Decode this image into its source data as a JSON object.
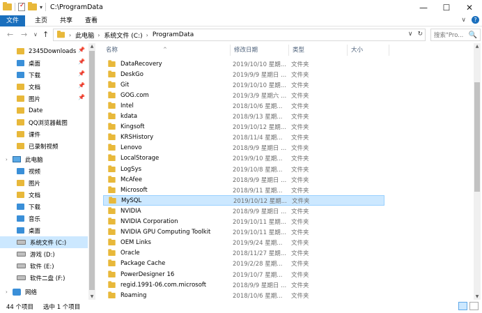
{
  "window": {
    "title": "C:\\ProgramData",
    "controls": {
      "minimize": "—",
      "maximize": "☐",
      "close": "✕"
    },
    "quick_access_dropdown": "▾"
  },
  "ribbon": {
    "tabs": [
      "文件",
      "主页",
      "共享",
      "查看"
    ],
    "expand_icon": "∨",
    "help_icon": "?"
  },
  "nav": {
    "back": "←",
    "forward": "→",
    "recent": "∨",
    "up": "↑",
    "breadcrumb": [
      "此电脑",
      "系统文件 (C:)",
      "ProgramData"
    ],
    "crumb_separator": "›",
    "address_dropdown": "∨",
    "refresh": "↻",
    "search_placeholder": "搜索\"Pro...",
    "search_icon": "🔍"
  },
  "sidebar": {
    "quick_access": [
      {
        "label": "2345Downloads",
        "icon": "folder-icon",
        "pinned": true
      },
      {
        "label": "桌面",
        "icon": "desktop-icon",
        "pinned": true
      },
      {
        "label": "下载",
        "icon": "download-icon",
        "pinned": true
      },
      {
        "label": "文档",
        "icon": "documents-icon",
        "pinned": true
      },
      {
        "label": "图片",
        "icon": "pictures-icon",
        "pinned": true
      },
      {
        "label": "Date",
        "icon": "folder-icon",
        "pinned": false
      },
      {
        "label": "QQ浏览器截图",
        "icon": "folder-icon",
        "pinned": false
      },
      {
        "label": "课件",
        "icon": "folder-icon",
        "pinned": false
      },
      {
        "label": "已录制视频",
        "icon": "folder-icon",
        "pinned": false
      }
    ],
    "pin_glyph": "📌",
    "this_pc": {
      "label": "此电脑",
      "icon": "this-pc-icon",
      "chevron": "›"
    },
    "pc_items": [
      {
        "label": "视频",
        "icon": "videos-icon"
      },
      {
        "label": "图片",
        "icon": "pictures-icon"
      },
      {
        "label": "文档",
        "icon": "documents-icon"
      },
      {
        "label": "下载",
        "icon": "download-icon"
      },
      {
        "label": "音乐",
        "icon": "music-icon"
      },
      {
        "label": "桌面",
        "icon": "desktop-icon"
      },
      {
        "label": "系统文件 (C:)",
        "icon": "drive-icon",
        "selected": true
      },
      {
        "label": "游戏 (D:)",
        "icon": "drive-icon"
      },
      {
        "label": "软件 (E:)",
        "icon": "drive-icon"
      },
      {
        "label": "软件二盘 (F:)",
        "icon": "drive-icon"
      }
    ],
    "network": {
      "label": "网络",
      "icon": "network-icon",
      "chevron": "›"
    }
  },
  "columns": {
    "name": "名称",
    "date": "修改日期",
    "type": "类型",
    "size": "大小",
    "sort_indicator": "^"
  },
  "files": [
    {
      "name": "DataRecovery",
      "date": "2019/10/10 星期...",
      "type": "文件夹"
    },
    {
      "name": "DeskGo",
      "date": "2019/9/9 星期日 ...",
      "type": "文件夹"
    },
    {
      "name": "Git",
      "date": "2019/10/10 星期...",
      "type": "文件夹"
    },
    {
      "name": "GOG.com",
      "date": "2019/3/9 星期六 ...",
      "type": "文件夹"
    },
    {
      "name": "Intel",
      "date": "2018/10/6 星期...",
      "type": "文件夹"
    },
    {
      "name": "kdata",
      "date": "2018/9/13 星期...",
      "type": "文件夹"
    },
    {
      "name": "Kingsoft",
      "date": "2019/10/12 星期...",
      "type": "文件夹"
    },
    {
      "name": "KRSHistory",
      "date": "2018/11/4 星期...",
      "type": "文件夹"
    },
    {
      "name": "Lenovo",
      "date": "2018/9/9 星期日 ...",
      "type": "文件夹"
    },
    {
      "name": "LocalStorage",
      "date": "2019/9/10 星期...",
      "type": "文件夹"
    },
    {
      "name": "LogSys",
      "date": "2019/10/8 星期...",
      "type": "文件夹"
    },
    {
      "name": "McAfee",
      "date": "2018/9/9 星期日 ...",
      "type": "文件夹"
    },
    {
      "name": "Microsoft",
      "date": "2018/9/11 星期...",
      "type": "文件夹"
    },
    {
      "name": "MySQL",
      "date": "2019/10/12 星期...",
      "type": "文件夹",
      "selected": true
    },
    {
      "name": "NVIDIA",
      "date": "2018/9/9 星期日 ...",
      "type": "文件夹"
    },
    {
      "name": "NVIDIA Corporation",
      "date": "2019/10/11 星期...",
      "type": "文件夹"
    },
    {
      "name": "NVIDIA GPU Computing Toolkit",
      "date": "2019/10/11 星期...",
      "type": "文件夹"
    },
    {
      "name": "OEM Links",
      "date": "2019/9/24 星期...",
      "type": "文件夹"
    },
    {
      "name": "Oracle",
      "date": "2018/11/27 星期...",
      "type": "文件夹"
    },
    {
      "name": "Package Cache",
      "date": "2019/2/28 星期...",
      "type": "文件夹"
    },
    {
      "name": "PowerDesigner 16",
      "date": "2019/10/7 星期...",
      "type": "文件夹"
    },
    {
      "name": "regid.1991-06.com.microsoft",
      "date": "2018/9/9 星期日 ...",
      "type": "文件夹"
    },
    {
      "name": "Roaming",
      "date": "2018/10/6 星期...",
      "type": "文件夹"
    }
  ],
  "status": {
    "item_count": "44 个项目",
    "selection": "选中 1 个项目"
  },
  "scrollbar_arrows": {
    "up": "▲",
    "down": "▼"
  },
  "colors": {
    "accent": "#1a6fbd",
    "selection": "#cce8ff",
    "folder": "#e8b83a"
  }
}
